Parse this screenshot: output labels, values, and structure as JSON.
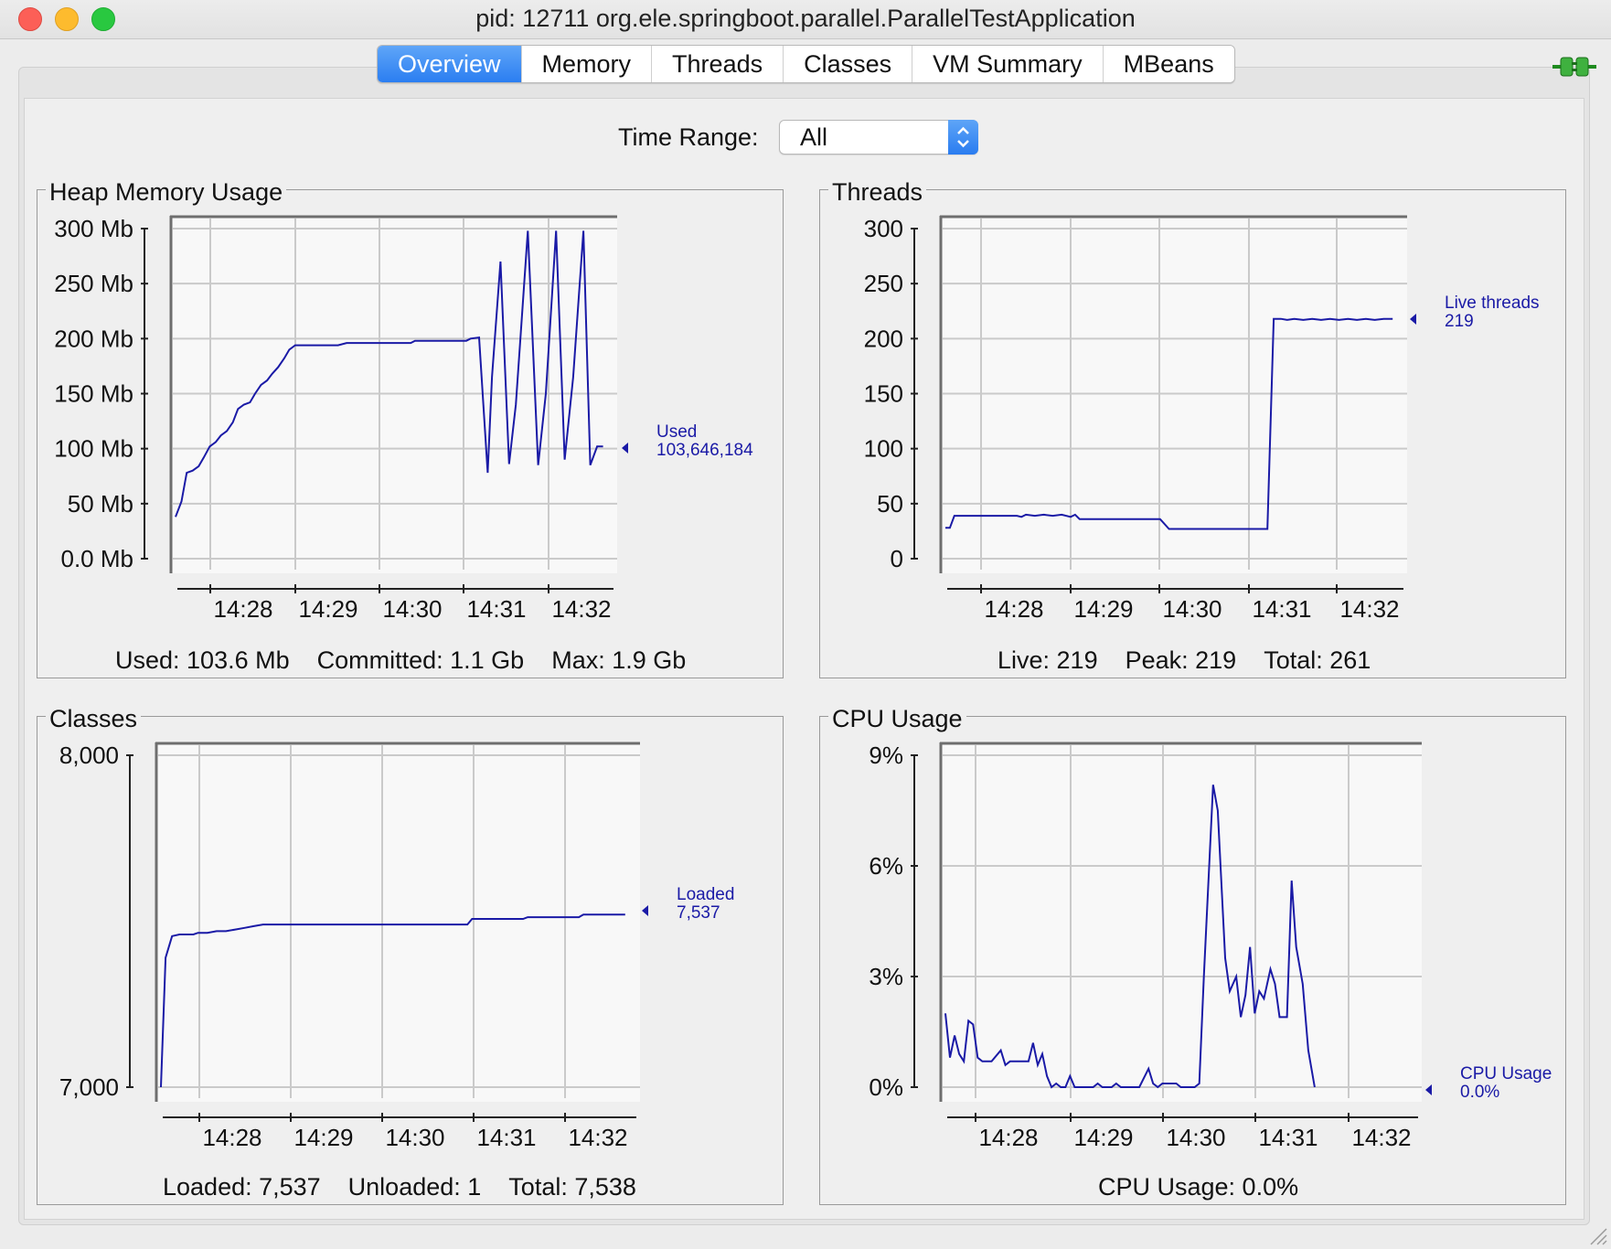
{
  "window": {
    "title": "pid: 12711 org.ele.springboot.parallel.ParallelTestApplication"
  },
  "tabs": [
    "Overview",
    "Memory",
    "Threads",
    "Classes",
    "VM Summary",
    "MBeans"
  ],
  "active_tab": "Overview",
  "time_range": {
    "label": "Time Range:",
    "value": "All"
  },
  "icons": {
    "connection": "connection-plug-icon",
    "resize": "resize-grip-icon"
  },
  "colors": {
    "series": "#1a1aa6",
    "active_tab": "#2b7ef1"
  },
  "panels": {
    "heap": {
      "title": "Heap Memory Usage",
      "summary": [
        "Used: 103.6 Mb",
        "Committed: 1.1 Gb",
        "Max: 1.9 Gb"
      ],
      "readout": [
        "Used",
        "103,646,184"
      ]
    },
    "threads": {
      "title": "Threads",
      "summary": [
        "Live: 219",
        "Peak: 219",
        "Total: 261"
      ],
      "readout": [
        "Live threads",
        "219"
      ]
    },
    "classes": {
      "title": "Classes",
      "summary": [
        "Loaded: 7,537",
        "Unloaded: 1",
        "Total: 7,538"
      ],
      "readout": [
        "Loaded",
        "7,537"
      ]
    },
    "cpu": {
      "title": "CPU Usage",
      "summary": [
        "CPU Usage: 0.0%"
      ],
      "readout": [
        "CPU Usage",
        "0.0%"
      ]
    }
  },
  "chart_data": [
    {
      "id": "heap",
      "type": "line",
      "x_ticks": [
        "14:28",
        "14:29",
        "14:30",
        "14:31",
        "14:32"
      ],
      "y_ticks": [
        "300 Mb",
        "250 Mb",
        "200 Mb",
        "150 Mb",
        "100 Mb",
        "50 Mb",
        "0.0 Mb"
      ],
      "ylim": [
        0,
        300
      ],
      "xlim": [
        27.6,
        32.7
      ],
      "series": [
        {
          "name": "Used",
          "points": [
            [
              27.6,
              38
            ],
            [
              27.67,
              52
            ],
            [
              27.73,
              78
            ],
            [
              27.8,
              80
            ],
            [
              27.87,
              84
            ],
            [
              27.93,
              92
            ],
            [
              28.0,
              102
            ],
            [
              28.07,
              106
            ],
            [
              28.13,
              112
            ],
            [
              28.2,
              116
            ],
            [
              28.27,
              124
            ],
            [
              28.33,
              136
            ],
            [
              28.4,
              140
            ],
            [
              28.47,
              142
            ],
            [
              28.53,
              150
            ],
            [
              28.6,
              158
            ],
            [
              28.67,
              162
            ],
            [
              28.73,
              168
            ],
            [
              28.8,
              174
            ],
            [
              28.87,
              182
            ],
            [
              28.93,
              190
            ],
            [
              29.0,
              194
            ],
            [
              29.5,
              194
            ],
            [
              29.6,
              196
            ],
            [
              30.35,
              196
            ],
            [
              30.4,
              198
            ],
            [
              31.0,
              198
            ],
            [
              31.05,
              200
            ],
            [
              31.15,
              201
            ],
            [
              31.25,
              78
            ],
            [
              31.3,
              165
            ],
            [
              31.4,
              270
            ],
            [
              31.5,
              86
            ],
            [
              31.58,
              140
            ],
            [
              31.72,
              298
            ],
            [
              31.84,
              85
            ],
            [
              31.93,
              150
            ],
            [
              32.05,
              298
            ],
            [
              32.15,
              90
            ],
            [
              32.25,
              165
            ],
            [
              32.37,
              298
            ],
            [
              32.45,
              85
            ],
            [
              32.53,
              102
            ],
            [
              32.6,
              102
            ]
          ]
        }
      ]
    },
    {
      "id": "threads",
      "type": "line",
      "x_ticks": [
        "14:28",
        "14:29",
        "14:30",
        "14:31",
        "14:32"
      ],
      "y_ticks": [
        "300",
        "250",
        "200",
        "150",
        "100",
        "50",
        "0"
      ],
      "ylim": [
        0,
        300
      ],
      "xlim": [
        27.6,
        32.7
      ],
      "series": [
        {
          "name": "Live threads",
          "points": [
            [
              27.6,
              28
            ],
            [
              27.65,
              28
            ],
            [
              27.7,
              39
            ],
            [
              28.4,
              39
            ],
            [
              28.45,
              38
            ],
            [
              28.5,
              40
            ],
            [
              28.6,
              39
            ],
            [
              28.7,
              40
            ],
            [
              28.8,
              39
            ],
            [
              28.9,
              40
            ],
            [
              29.0,
              38
            ],
            [
              29.05,
              40
            ],
            [
              29.1,
              36
            ],
            [
              30.0,
              36
            ],
            [
              30.1,
              27
            ],
            [
              31.2,
              27
            ],
            [
              31.27,
              218
            ],
            [
              31.35,
              218
            ],
            [
              31.42,
              217
            ],
            [
              31.5,
              218
            ],
            [
              31.6,
              217
            ],
            [
              31.7,
              218
            ],
            [
              31.8,
              217
            ],
            [
              31.9,
              218
            ],
            [
              32.0,
              217
            ],
            [
              32.1,
              218
            ],
            [
              32.2,
              217
            ],
            [
              32.3,
              218
            ],
            [
              32.4,
              217
            ],
            [
              32.5,
              218
            ],
            [
              32.6,
              218
            ]
          ]
        }
      ]
    },
    {
      "id": "classes",
      "type": "line",
      "x_ticks": [
        "14:28",
        "14:29",
        "14:30",
        "14:31",
        "14:32"
      ],
      "y_ticks": [
        "8,000",
        "7,000"
      ],
      "ylim": [
        7000,
        8000
      ],
      "xlim": [
        27.6,
        32.7
      ],
      "series": [
        {
          "name": "Loaded",
          "points": [
            [
              27.6,
              7000
            ],
            [
              27.65,
              7390
            ],
            [
              27.72,
              7455
            ],
            [
              27.8,
              7460
            ],
            [
              27.95,
              7460
            ],
            [
              28.0,
              7465
            ],
            [
              28.1,
              7465
            ],
            [
              28.2,
              7470
            ],
            [
              28.3,
              7470
            ],
            [
              28.4,
              7475
            ],
            [
              28.5,
              7480
            ],
            [
              28.6,
              7485
            ],
            [
              28.7,
              7490
            ],
            [
              29.0,
              7490
            ],
            [
              30.9,
              7490
            ],
            [
              30.95,
              7507
            ],
            [
              31.5,
              7507
            ],
            [
              31.55,
              7512
            ],
            [
              32.1,
              7512
            ],
            [
              32.15,
              7520
            ],
            [
              32.6,
              7520
            ]
          ]
        }
      ]
    },
    {
      "id": "cpu",
      "type": "line",
      "x_ticks": [
        "14:28",
        "14:29",
        "14:30",
        "14:31",
        "14:32"
      ],
      "y_ticks": [
        "9%",
        "6%",
        "3%",
        "0%"
      ],
      "ylim": [
        0,
        9
      ],
      "xlim": [
        27.6,
        32.7
      ],
      "series": [
        {
          "name": "CPU Usage",
          "points": [
            [
              27.6,
              2.0
            ],
            [
              27.65,
              0.8
            ],
            [
              27.7,
              1.4
            ],
            [
              27.75,
              0.9
            ],
            [
              27.8,
              0.7
            ],
            [
              27.85,
              1.8
            ],
            [
              27.9,
              1.7
            ],
            [
              27.95,
              0.8
            ],
            [
              28.0,
              0.7
            ],
            [
              28.1,
              0.7
            ],
            [
              28.2,
              1.0
            ],
            [
              28.25,
              0.6
            ],
            [
              28.3,
              0.7
            ],
            [
              28.5,
              0.7
            ],
            [
              28.55,
              1.2
            ],
            [
              28.6,
              0.6
            ],
            [
              28.65,
              0.9
            ],
            [
              28.7,
              0.3
            ],
            [
              28.75,
              0.0
            ],
            [
              28.8,
              0.1
            ],
            [
              28.85,
              0.0
            ],
            [
              28.9,
              0.0
            ],
            [
              28.95,
              0.3
            ],
            [
              29.0,
              0.0
            ],
            [
              29.2,
              0.0
            ],
            [
              29.25,
              0.1
            ],
            [
              29.3,
              0.0
            ],
            [
              29.4,
              0.0
            ],
            [
              29.45,
              0.1
            ],
            [
              29.5,
              0.0
            ],
            [
              29.7,
              0.0
            ],
            [
              29.8,
              0.5
            ],
            [
              29.85,
              0.1
            ],
            [
              29.9,
              0.0
            ],
            [
              29.95,
              0.1
            ],
            [
              30.1,
              0.1
            ],
            [
              30.15,
              0.0
            ],
            [
              30.3,
              0.0
            ],
            [
              30.35,
              0.1
            ],
            [
              30.4,
              3.0
            ],
            [
              30.5,
              8.2
            ],
            [
              30.55,
              7.5
            ],
            [
              30.63,
              3.5
            ],
            [
              30.68,
              2.6
            ],
            [
              30.75,
              3.0
            ],
            [
              30.8,
              1.9
            ],
            [
              30.85,
              2.5
            ],
            [
              30.9,
              3.8
            ],
            [
              30.95,
              2.0
            ],
            [
              31.0,
              2.6
            ],
            [
              31.05,
              2.4
            ],
            [
              31.12,
              3.2
            ],
            [
              31.17,
              2.8
            ],
            [
              31.22,
              1.9
            ],
            [
              31.3,
              1.9
            ],
            [
              31.35,
              5.6
            ],
            [
              31.4,
              3.8
            ],
            [
              31.47,
              2.8
            ],
            [
              31.53,
              1.0
            ],
            [
              31.6,
              0.0
            ]
          ]
        }
      ]
    }
  ]
}
